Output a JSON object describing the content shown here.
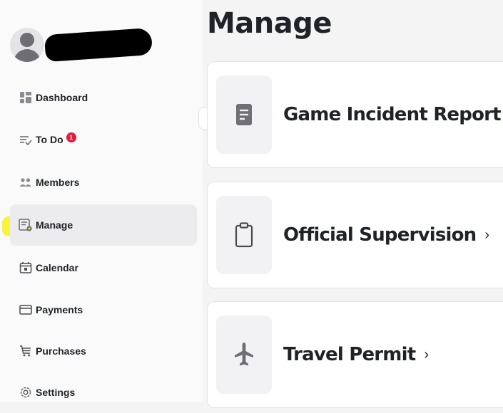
{
  "sidebar": {
    "items": [
      {
        "label": "Dashboard",
        "icon": "dashboard-icon"
      },
      {
        "label": "To Do",
        "icon": "todo-icon",
        "badge": "1"
      },
      {
        "label": "Members",
        "icon": "members-icon"
      },
      {
        "label": "Manage",
        "icon": "manage-icon",
        "active": true
      },
      {
        "label": "Calendar",
        "icon": "calendar-icon"
      },
      {
        "label": "Payments",
        "icon": "payments-icon"
      },
      {
        "label": "Purchases",
        "icon": "cart-icon"
      },
      {
        "label": "Settings",
        "icon": "settings-icon"
      }
    ]
  },
  "main": {
    "title": "Manage",
    "cards": [
      {
        "label": "Game Incident Report",
        "icon": "document-icon"
      },
      {
        "label": "Official Supervision",
        "icon": "clipboard-icon"
      },
      {
        "label": "Travel Permit",
        "icon": "airplane-icon"
      }
    ]
  },
  "colors": {
    "badge": "#e5193a",
    "highlight": "#f5f21a",
    "active_bg": "#ececee"
  }
}
